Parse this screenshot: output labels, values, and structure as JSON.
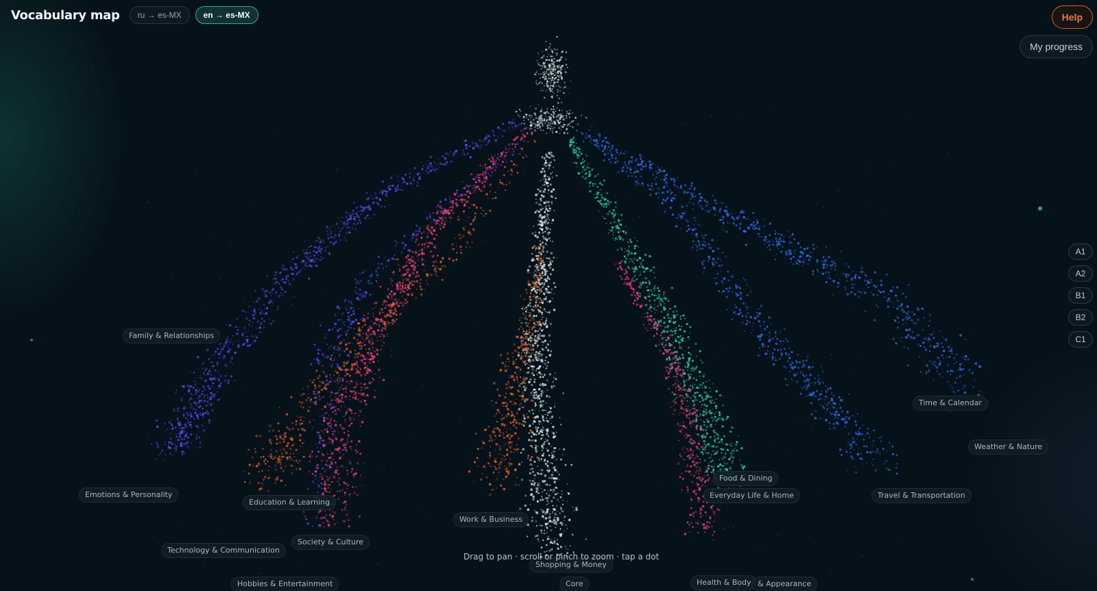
{
  "header": {
    "title": "Vocabulary map",
    "language_pairs": [
      {
        "label": "ru → es-MX",
        "active": false
      },
      {
        "label": "en → es-MX",
        "active": true
      }
    ]
  },
  "help_label": "Help",
  "progress_label": "My progress",
  "levels": [
    "A1",
    "A2",
    "B1",
    "B2",
    "C1"
  ],
  "topics": [
    "Family & Relationships",
    "Time & Calendar",
    "Weather & Nature",
    "Food & Dining",
    "Emotions & Personality",
    "Education & Learning",
    "Everyday Life & Home",
    "Travel & Transportation",
    "Work & Business",
    "Technology & Communication",
    "Society & Culture",
    "Shopping & Money",
    "Hobbies & Entertainment",
    "Core",
    "Health & Body",
    "& Appearance"
  ],
  "hint": "Drag to pan · scroll or pinch to zoom · tap a dot",
  "colors": {
    "background": "#06121a",
    "accent_teal": "#3aa89a",
    "help_orange": "#f07a3c",
    "cluster_violet": "#5a48f0",
    "cluster_orange": "#e0602a",
    "cluster_pink": "#f0407a",
    "cluster_teal": "#30c8a8",
    "cluster_blue": "#2f6ff0",
    "cluster_white": "#d8ecec"
  }
}
